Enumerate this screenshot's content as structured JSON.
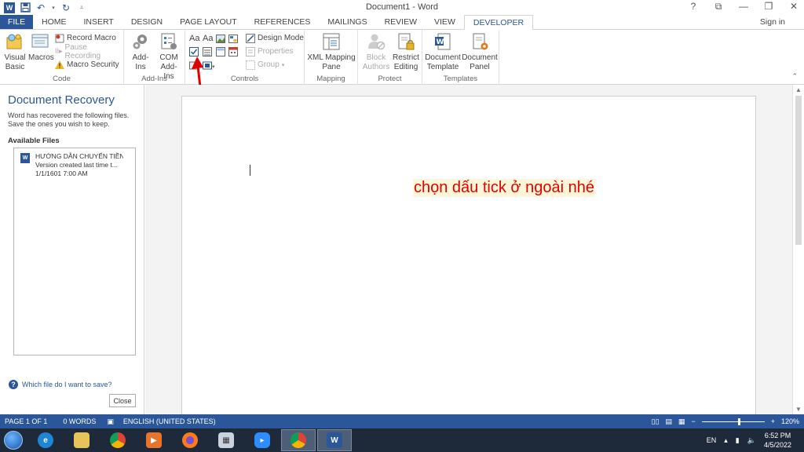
{
  "window": {
    "title": "Document1 - Word",
    "help": "?",
    "controls": [
      "⧉",
      "—",
      "❐",
      "✕"
    ]
  },
  "tabs": [
    {
      "label": "FILE"
    },
    {
      "label": "HOME"
    },
    {
      "label": "INSERT"
    },
    {
      "label": "DESIGN"
    },
    {
      "label": "PAGE LAYOUT"
    },
    {
      "label": "REFERENCES"
    },
    {
      "label": "MAILINGS"
    },
    {
      "label": "REVIEW"
    },
    {
      "label": "VIEW"
    },
    {
      "label": "DEVELOPER"
    }
  ],
  "signin": "Sign in",
  "ribbon": {
    "code": {
      "label": "Code",
      "visual_basic": "Visual\nBasic",
      "macros": "Macros",
      "record_macro": "Record Macro",
      "pause_recording": "Pause Recording",
      "macro_security": "Macro Security"
    },
    "addins": {
      "label": "Add-Ins",
      "addins": "Add-Ins",
      "com_addins": "COM\nAdd-Ins"
    },
    "controls": {
      "label": "Controls",
      "design_mode": "Design Mode",
      "properties": "Properties",
      "group": "Group",
      "aa1": "Aa",
      "aa2": "Aa"
    },
    "mapping": {
      "label": "Mapping",
      "xml_mapping": "XML Mapping\nPane"
    },
    "protect": {
      "label": "Protect",
      "block_authors": "Block\nAuthors",
      "restrict_editing": "Restrict\nEditing"
    },
    "templates": {
      "label": "Templates",
      "document_template": "Document\nTemplate",
      "document_panel": "Document\nPanel"
    }
  },
  "recovery": {
    "title": "Document Recovery",
    "desc1": "Word has recovered the following files.",
    "desc2": "Save the ones you wish to keep.",
    "available": "Available Files",
    "file": {
      "name": "HƯỚNG DẪN CHUYỂN TIỀN...",
      "version": "Version created last time t...",
      "date": "1/1/1601 7:00 AM"
    },
    "help": "Which file do I want to save?",
    "close": "Close"
  },
  "document": {
    "text": "chọn dấu tick ở ngoài nhé"
  },
  "status": {
    "page": "PAGE 1 OF 1",
    "words": "0 WORDS",
    "language": "ENGLISH (UNITED STATES)",
    "zoom_minus": "−",
    "zoom_plus": "+",
    "zoom": "120%"
  },
  "taskbar": {
    "lang": "EN",
    "time": "6:52 PM",
    "date": "4/5/2022"
  },
  "colors": {
    "accent": "#2b579a",
    "annotation": "#e30000"
  }
}
